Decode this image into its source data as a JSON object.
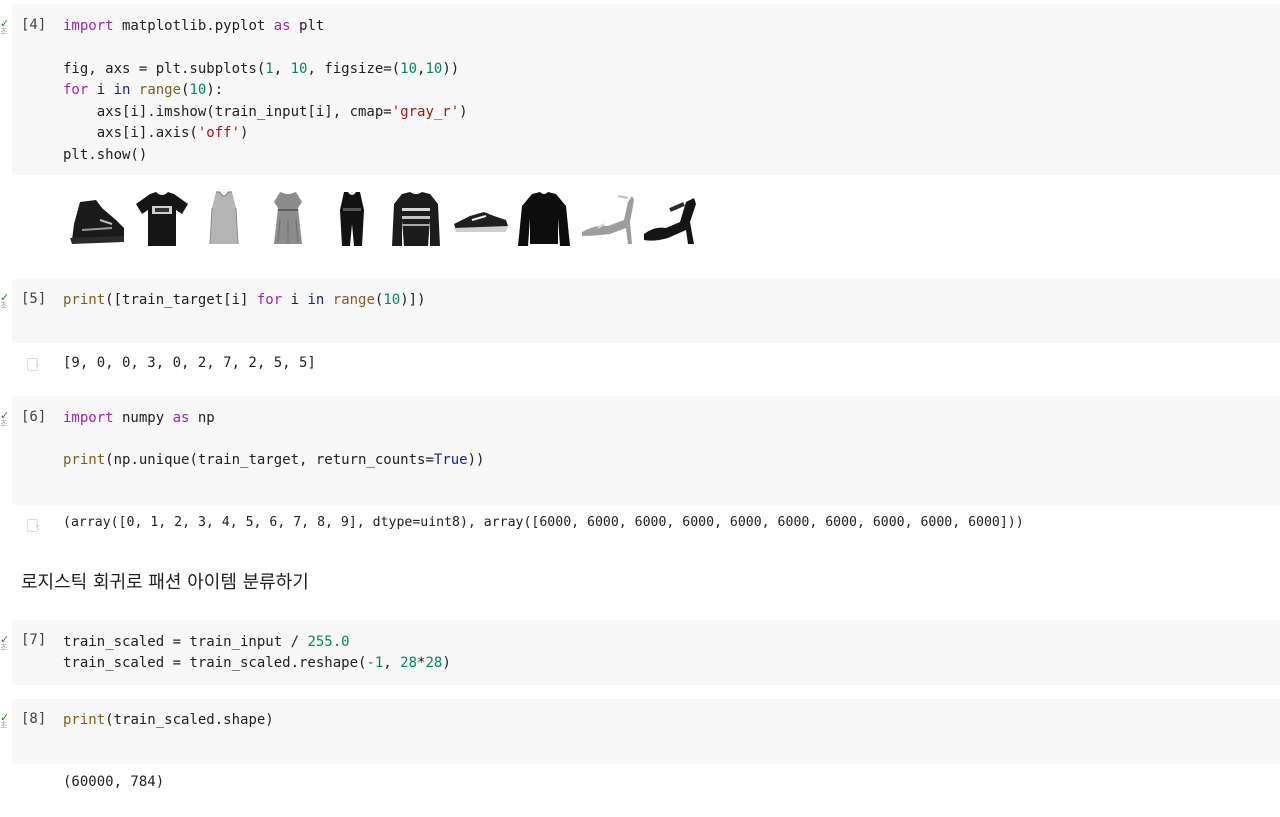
{
  "cells": [
    {
      "id": "cell-4",
      "exec_count": "[4]",
      "code": [
        "import matplotlib.pyplot as plt",
        "",
        "fig, axs = plt.subplots(1, 10, figsize=(10,10))",
        "for i in range(10):",
        "    axs[i].imshow(train_input[i], cmap='gray_r')",
        "    axs[i].axis('off')",
        "plt.show()"
      ],
      "output_images": [
        "ankle-boot",
        "t-shirt",
        "t-shirt",
        "dress",
        "t-shirt",
        "pullover",
        "sneaker",
        "pullover",
        "sandal",
        "sandal"
      ]
    },
    {
      "id": "cell-5",
      "exec_count": "[5]",
      "code": [
        "print([train_target[i] for i in range(10)])"
      ],
      "output": "[9, 0, 0, 3, 0, 2, 7, 2, 5, 5]"
    },
    {
      "id": "cell-6",
      "exec_count": "[6]",
      "code": [
        "import numpy as np",
        "",
        "print(np.unique(train_target, return_counts=True))"
      ],
      "output": "(array([0, 1, 2, 3, 4, 5, 6, 7, 8, 9], dtype=uint8), array([6000, 6000, 6000, 6000, 6000, 6000, 6000, 6000, 6000, 6000]))"
    },
    {
      "id": "markdown-1",
      "text": "로지스틱 회귀로 패션 아이템 분류하기"
    },
    {
      "id": "cell-7",
      "exec_count": "[7]",
      "code": [
        "train_scaled = train_input / 255.0",
        "train_scaled = train_scaled.reshape(-1, 28*28)"
      ]
    },
    {
      "id": "cell-8",
      "exec_count": "[8]",
      "code": [
        "print(train_scaled.shape)"
      ],
      "output": "(60000, 784)"
    }
  ],
  "gutter": {
    "check_glyph": "✓",
    "seconds_glyph": "초"
  },
  "colors": {
    "cell_bg": "#f7f7f7",
    "keyword": "#9c27b0",
    "keyword_in": "#1a237e",
    "builtin": "#795e26",
    "number": "#098658",
    "string": "#a31515",
    "check": "#2e7d32"
  }
}
